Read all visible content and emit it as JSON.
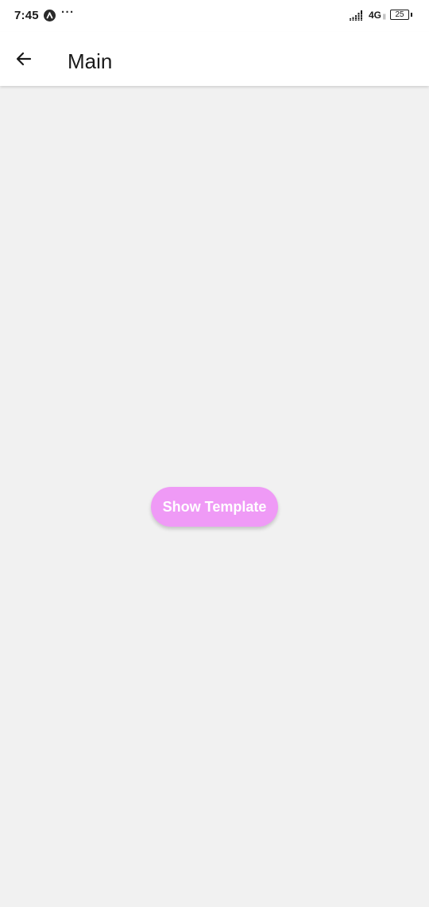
{
  "status_bar": {
    "time": "7:45",
    "app_icon": "app-notification-icon",
    "more": "···",
    "network": "4G",
    "network_sub": "||",
    "battery": "25"
  },
  "app_bar": {
    "back_icon": "arrow-left-icon",
    "title": "Main"
  },
  "main": {
    "button_label": "Show Template",
    "button_color": "#ef9af6"
  },
  "colors": {
    "background": "#f1f1f1",
    "app_bar": "#ffffff",
    "text": "#1a1a1a"
  }
}
